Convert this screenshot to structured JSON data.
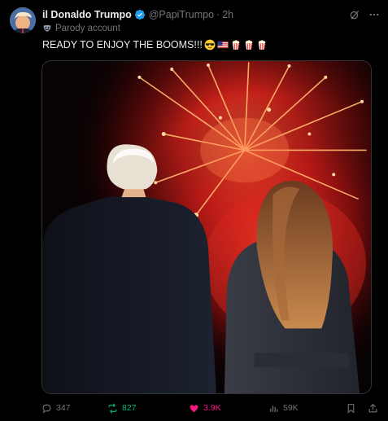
{
  "post": {
    "display_name": "il Donaldo Trumpo",
    "handle": "@PapiTrumpo",
    "separator": "·",
    "time": "2h",
    "parody_label": "Parody account",
    "text": "READY TO ENJOY THE BOOMS!!!",
    "emojis": [
      "sunglasses-face-emoji",
      "us-flag-emoji",
      "popcorn-emoji",
      "popcorn-emoji",
      "popcorn-emoji"
    ]
  },
  "media": {
    "alt": "Two people seen from behind watching red fireworks at night"
  },
  "actions": {
    "replies": "347",
    "reposts": "827",
    "likes": "3.9K",
    "views": "59K"
  },
  "colors": {
    "background": "#000000",
    "text": "#e7e9ea",
    "muted": "#71767b",
    "verified": "#1d9bf0",
    "repost_active": "#00ba7c",
    "like_active": "#f91880"
  }
}
